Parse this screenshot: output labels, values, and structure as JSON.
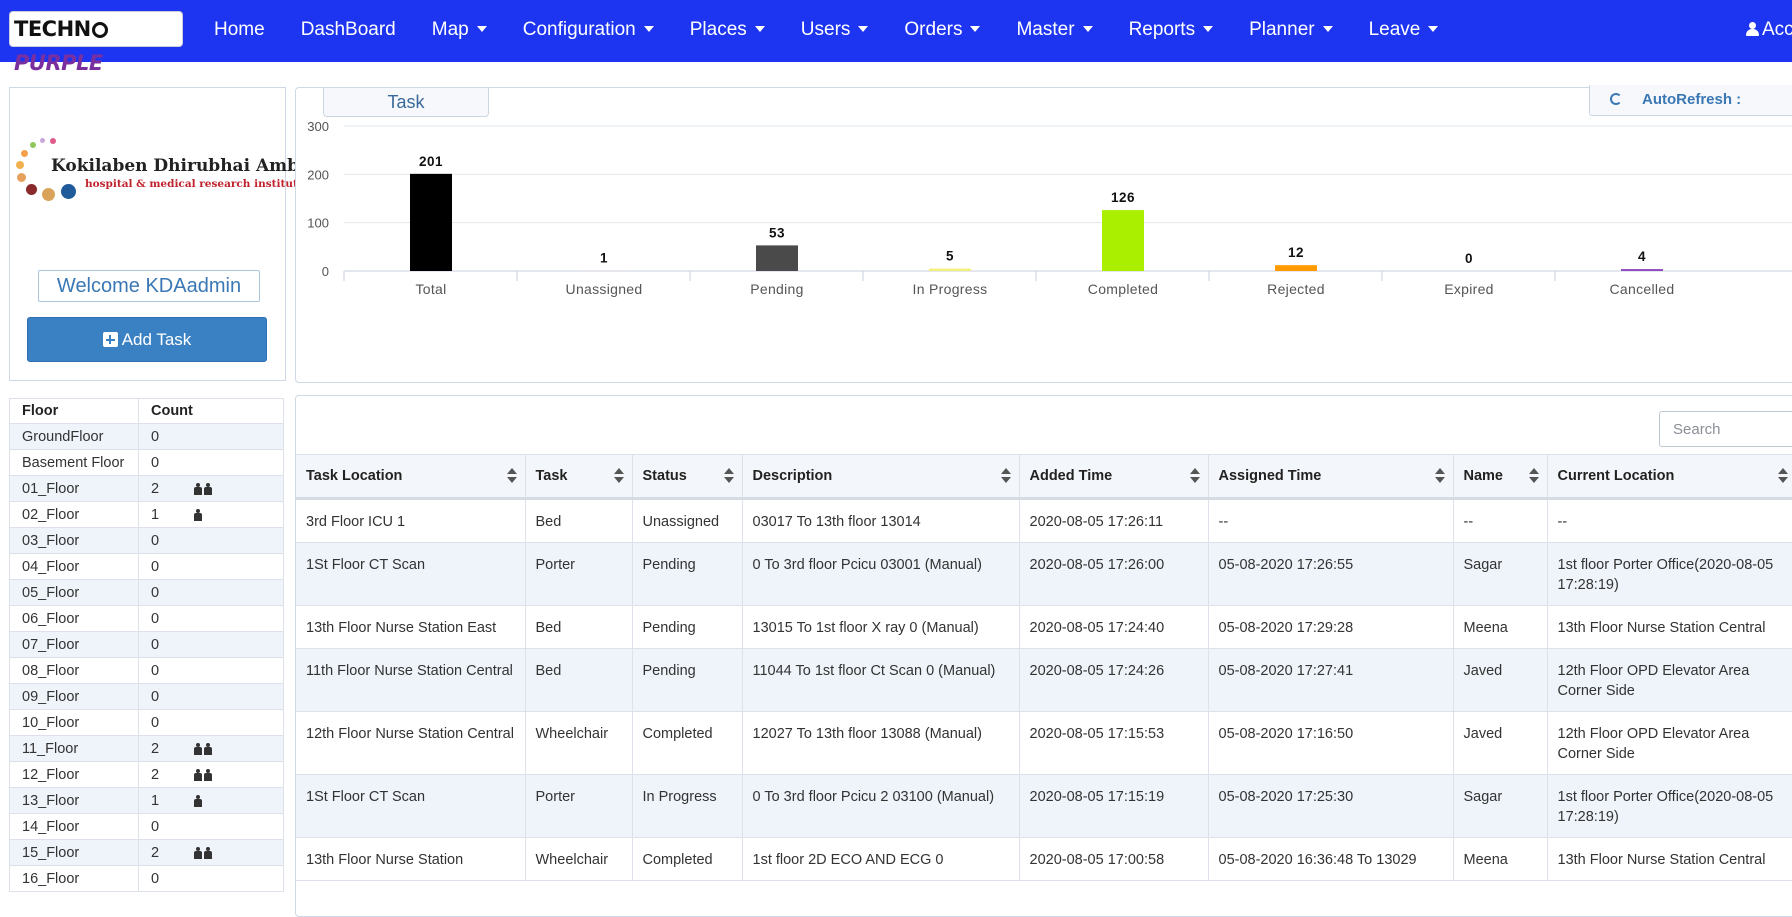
{
  "brand": {
    "part1": "TECHN",
    "part2": "PURPLE"
  },
  "nav": {
    "items": [
      {
        "label": "Home",
        "dropdown": false
      },
      {
        "label": "DashBoard",
        "dropdown": false
      },
      {
        "label": "Map",
        "dropdown": true
      },
      {
        "label": "Configuration",
        "dropdown": true
      },
      {
        "label": "Places",
        "dropdown": true
      },
      {
        "label": "Users",
        "dropdown": true
      },
      {
        "label": "Orders",
        "dropdown": true
      },
      {
        "label": "Master",
        "dropdown": true
      },
      {
        "label": "Reports",
        "dropdown": true
      },
      {
        "label": "Planner",
        "dropdown": true
      },
      {
        "label": "Leave",
        "dropdown": true
      }
    ],
    "account_label": "Acc"
  },
  "org": {
    "name": "Kokilaben Dhirubhai Ambani",
    "subtitle": "hospital & medical research institute"
  },
  "welcome_text": "Welcome KDAadmin",
  "add_task_label": "Add Task",
  "floors": {
    "headers": [
      "Floor",
      "Count"
    ],
    "rows": [
      {
        "floor": "GroundFloor",
        "count": "0",
        "people": 0
      },
      {
        "floor": "Basement Floor",
        "count": "0",
        "people": 0
      },
      {
        "floor": "01_Floor",
        "count": "2",
        "people": 2
      },
      {
        "floor": "02_Floor",
        "count": "1",
        "people": 1
      },
      {
        "floor": "03_Floor",
        "count": "0",
        "people": 0
      },
      {
        "floor": "04_Floor",
        "count": "0",
        "people": 0
      },
      {
        "floor": "05_Floor",
        "count": "0",
        "people": 0
      },
      {
        "floor": "06_Floor",
        "count": "0",
        "people": 0
      },
      {
        "floor": "07_Floor",
        "count": "0",
        "people": 0
      },
      {
        "floor": "08_Floor",
        "count": "0",
        "people": 0
      },
      {
        "floor": "09_Floor",
        "count": "0",
        "people": 0
      },
      {
        "floor": "10_Floor",
        "count": "0",
        "people": 0
      },
      {
        "floor": "11_Floor",
        "count": "2",
        "people": 2
      },
      {
        "floor": "12_Floor",
        "count": "2",
        "people": 2
      },
      {
        "floor": "13_Floor",
        "count": "1",
        "people": 1
      },
      {
        "floor": "14_Floor",
        "count": "0",
        "people": 0
      },
      {
        "floor": "15_Floor",
        "count": "2",
        "people": 2
      },
      {
        "floor": "16_Floor",
        "count": "0",
        "people": 0
      }
    ]
  },
  "task_tab_label": "Task",
  "autorefresh_label": "AutoRefresh :",
  "chart_data": {
    "type": "bar",
    "categories": [
      "Total",
      "Unassigned",
      "Pending",
      "In Progress",
      "Completed",
      "Rejected",
      "Expired",
      "Cancelled"
    ],
    "values": [
      201,
      1,
      53,
      5,
      126,
      12,
      0,
      4
    ],
    "colors": [
      "#000000",
      "#cccccc",
      "#4a4a4a",
      "#f5f07a",
      "#aaee00",
      "#ff9a00",
      "#cccccc",
      "#8e4bc0"
    ],
    "yticks": [
      0,
      100,
      200,
      300
    ],
    "ylim": [
      0,
      300
    ]
  },
  "search": {
    "placeholder": "Search"
  },
  "tasks": {
    "columns": [
      "Task Location",
      "Task",
      "Status",
      "Description",
      "Added Time",
      "Assigned Time",
      "Name",
      "Current Location"
    ],
    "rows": [
      [
        "3rd Floor ICU 1",
        "Bed",
        "Unassigned",
        "03017 To 13th floor 13014",
        "2020-08-05 17:26:11",
        "--",
        "--",
        "--"
      ],
      [
        "1St Floor CT Scan",
        "Porter",
        "Pending",
        "0 To 3rd floor Pcicu 03001 (Manual)",
        "2020-08-05 17:26:00",
        "05-08-2020 17:26:55",
        "Sagar",
        "1st floor Porter Office(2020-08-05 17:28:19)"
      ],
      [
        "13th Floor Nurse Station East",
        "Bed",
        "Pending",
        "13015 To 1st floor X ray 0 (Manual)",
        "2020-08-05 17:24:40",
        "05-08-2020 17:29:28",
        "Meena",
        "13th Floor Nurse Station Central"
      ],
      [
        "11th Floor Nurse Station Central",
        "Bed",
        "Pending",
        "11044 To 1st floor Ct Scan 0 (Manual)",
        "2020-08-05 17:24:26",
        "05-08-2020 17:27:41",
        "Javed",
        "12th Floor OPD Elevator Area Corner Side"
      ],
      [
        "12th Floor Nurse Station Central",
        "Wheelchair",
        "Completed",
        "12027 To 13th floor 13088 (Manual)",
        "2020-08-05 17:15:53",
        "05-08-2020 17:16:50",
        "Javed",
        "12th Floor OPD Elevator Area Corner Side"
      ],
      [
        "1St Floor CT Scan",
        "Porter",
        "In Progress",
        "0 To 3rd floor Pcicu 2 03100 (Manual)",
        "2020-08-05 17:15:19",
        "05-08-2020 17:25:30",
        "Sagar",
        "1st floor Porter Office(2020-08-05 17:28:19)"
      ],
      [
        "13th Floor Nurse Station",
        "Wheelchair",
        "Completed",
        "1st floor 2D ECO AND ECG 0",
        "2020-08-05 17:00:58",
        "05-08-2020 16:36:48 To 13029",
        "Meena",
        "13th Floor Nurse Station Central"
      ]
    ]
  }
}
